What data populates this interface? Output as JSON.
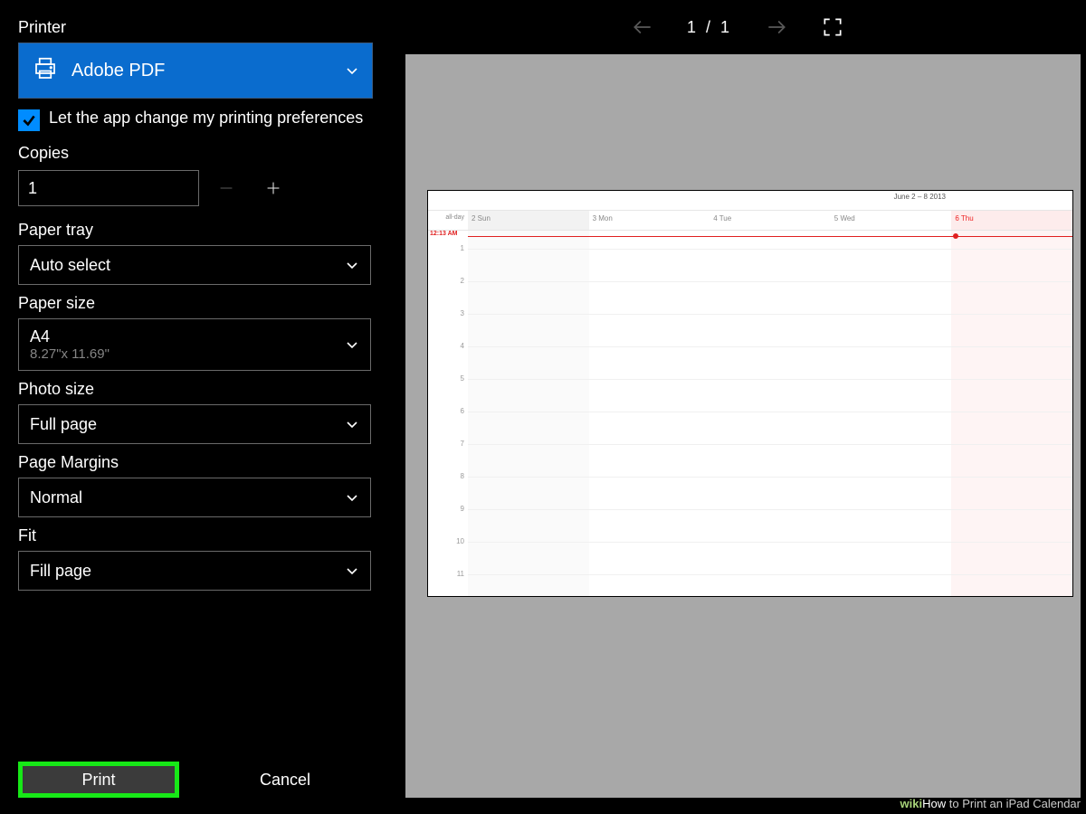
{
  "labels": {
    "printer": "Printer",
    "copies": "Copies",
    "paper_tray": "Paper tray",
    "paper_size": "Paper size",
    "photo_size": "Photo size",
    "page_margins": "Page Margins",
    "fit": "Fit"
  },
  "printer_select": {
    "name": "Adobe PDF"
  },
  "pref_checkbox": {
    "label": "Let the app change my printing preferences",
    "checked": true
  },
  "copies": {
    "value": "1"
  },
  "paper_tray": {
    "value": "Auto select"
  },
  "paper_size": {
    "value": "A4",
    "sub": "8.27\"x 11.69\""
  },
  "photo_size": {
    "value": "Full page"
  },
  "page_margins": {
    "value": "Normal"
  },
  "fit": {
    "value": "Fill page"
  },
  "actions": {
    "print": "Print",
    "cancel": "Cancel"
  },
  "preview": {
    "page_indicator": "1  /  1",
    "calendar": {
      "title_fragment": "June 2 – 8 2013",
      "allday_label": "all-day",
      "days": [
        {
          "label": "2 Sun",
          "shade": true
        },
        {
          "label": "3 Mon"
        },
        {
          "label": "4 Tue"
        },
        {
          "label": "5 Wed"
        },
        {
          "label": "6 Thu",
          "today": true
        }
      ],
      "now_label": "12:13 AM",
      "hours": [
        "1",
        "2",
        "3",
        "4",
        "5",
        "6",
        "7",
        "8",
        "9",
        "10",
        "11"
      ]
    }
  },
  "watermark": {
    "brand1": "wiki",
    "brand2": "How",
    "text": " to Print an iPad Calendar"
  }
}
